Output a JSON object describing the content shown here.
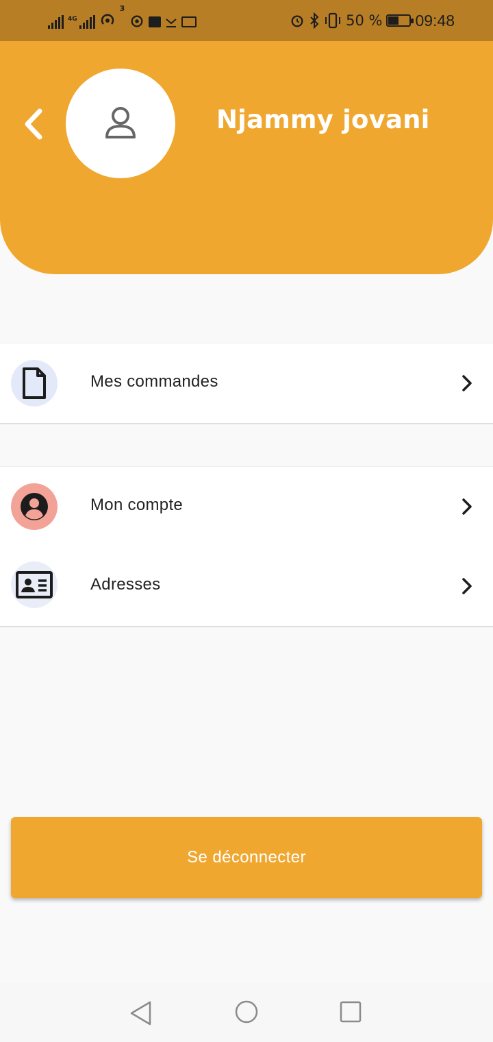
{
  "status_bar": {
    "network_label_1": "4G",
    "notification_count": "3",
    "battery_percent": "50 %",
    "battery_level": 0.5,
    "time": "09:48"
  },
  "profile": {
    "user_name": "Njammy jovani"
  },
  "menu": {
    "section1": [
      {
        "label": "Mes commandes",
        "icon": "document-icon",
        "icon_bg": "#e4e9fa"
      }
    ],
    "section2": [
      {
        "label": "Mon compte",
        "icon": "account-circle-icon",
        "icon_bg": "#f3a298"
      },
      {
        "label": "Adresses",
        "icon": "contact-card-icon",
        "icon_bg": "#e9edf8"
      }
    ]
  },
  "logout": {
    "label": "Se déconnecter"
  },
  "colors": {
    "accent": "#f0a72f",
    "status_bar": "#b87e25",
    "background": "#f9f9f9"
  },
  "navigation": {
    "back_icon": "back-icon",
    "home_icon": "home-icon",
    "recents_icon": "recents-icon"
  }
}
